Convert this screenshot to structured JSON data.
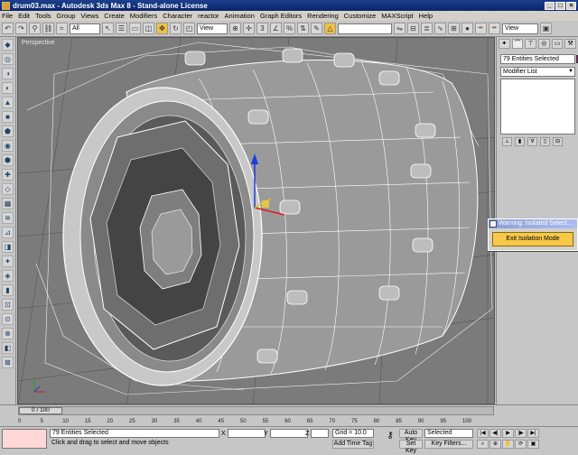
{
  "window": {
    "title": "drum03.max - Autodesk 3ds Max 8 - Stand-alone License",
    "btn_min": "_",
    "btn_max": "□",
    "btn_close": "×"
  },
  "menu": [
    "File",
    "Edit",
    "Tools",
    "Group",
    "Views",
    "Create",
    "Modifiers",
    "Character",
    "reactor",
    "Animation",
    "Graph Editors",
    "Rendering",
    "Customize",
    "MAXScript",
    "Help"
  ],
  "toolbar": {
    "selection_filter": "All",
    "ref_coord": "View",
    "named_selection": "",
    "render_preset": "View"
  },
  "viewport": {
    "label": "Perspective"
  },
  "command_panel": {
    "selection_name": "79 Entities Selected",
    "modifier_list": "Modifier List",
    "selection_color": "#7a1f5e"
  },
  "isolation_dialog": {
    "title": "Warning: Isolated Select...",
    "button": "Exit Isolation Mode"
  },
  "timeline": {
    "position": "0 / 100",
    "ticks": [
      "0",
      "5",
      "10",
      "15",
      "20",
      "25",
      "30",
      "35",
      "40",
      "45",
      "50",
      "55",
      "60",
      "65",
      "70",
      "75",
      "80",
      "85",
      "90",
      "95",
      "100"
    ]
  },
  "status": {
    "selection": "79 Entities Selected",
    "prompt": "Click and drag to select and move objects",
    "x_label": "X",
    "y_label": "Y",
    "z_label": "Z",
    "grid": "Grid = 10.0",
    "add_time_tag": "Add Time Tag",
    "auto_key": "Auto Key",
    "set_key": "Set Key",
    "key_mode": "Selected",
    "key_filters": "Key Filters..."
  },
  "colors": {
    "title_bar": "#0a246a",
    "viewport_bg": "#7b7b7b",
    "wire": "#ffffff",
    "accent_button": "#f7c84a"
  }
}
